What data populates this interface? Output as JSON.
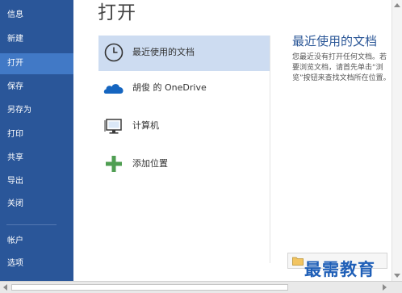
{
  "page": {
    "title": "打开"
  },
  "sidebar": {
    "items": [
      {
        "label": "信息"
      },
      {
        "label": "新建"
      },
      {
        "label": "打开",
        "active": true
      },
      {
        "label": "保存"
      },
      {
        "label": "另存为"
      },
      {
        "label": "打印"
      },
      {
        "label": "共享"
      },
      {
        "label": "导出"
      },
      {
        "label": "关闭"
      },
      {
        "label": "帐户"
      },
      {
        "label": "选项"
      }
    ]
  },
  "places": [
    {
      "label": "最近使用的文档",
      "icon": "clock-icon",
      "selected": true
    },
    {
      "label": "胡俊 的 OneDrive",
      "icon": "onedrive-cloud-icon"
    },
    {
      "label": "计算机",
      "icon": "computer-icon"
    },
    {
      "label": "添加位置",
      "icon": "plus-icon"
    }
  ],
  "right_panel": {
    "title": "最近使用的文档",
    "message": "您最近没有打开任何文档。若要浏览文档，请首先单击“浏览”按钮来查找文档所在位置。"
  },
  "watermark": {
    "text": "最需教育"
  },
  "colors": {
    "sidebar_bg": "#2a5699",
    "sidebar_active": "#4179c6",
    "selected_place": "#cddcf1",
    "accent": "#2b5797",
    "onedrive_blue": "#1565c0",
    "add_green": "#4f9e52"
  }
}
